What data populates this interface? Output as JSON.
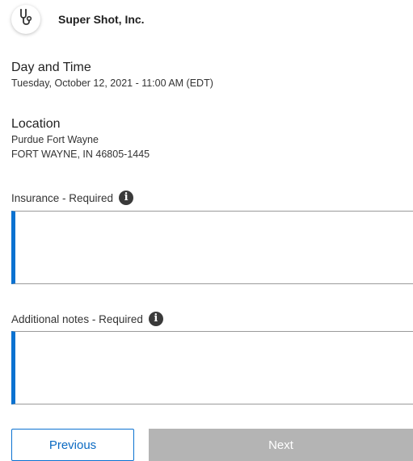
{
  "header": {
    "company_name": "Super Shot, Inc.",
    "logo_icon": "stethoscope-icon"
  },
  "appointment": {
    "day_time_title": "Day and Time",
    "day_time_value": "Tuesday, October 12, 2021 - 11:00 AM (EDT)",
    "location_title": "Location",
    "location_name": "Purdue Fort Wayne",
    "location_address": "FORT WAYNE, IN 46805-1445"
  },
  "form": {
    "insurance_label": "Insurance - Required",
    "insurance_value": "",
    "notes_label": "Additional notes - Required",
    "notes_value": "",
    "info_icon": "info-icon",
    "accent_color": "#0b72d1"
  },
  "buttons": {
    "previous_label": "Previous",
    "next_label": "Next"
  }
}
